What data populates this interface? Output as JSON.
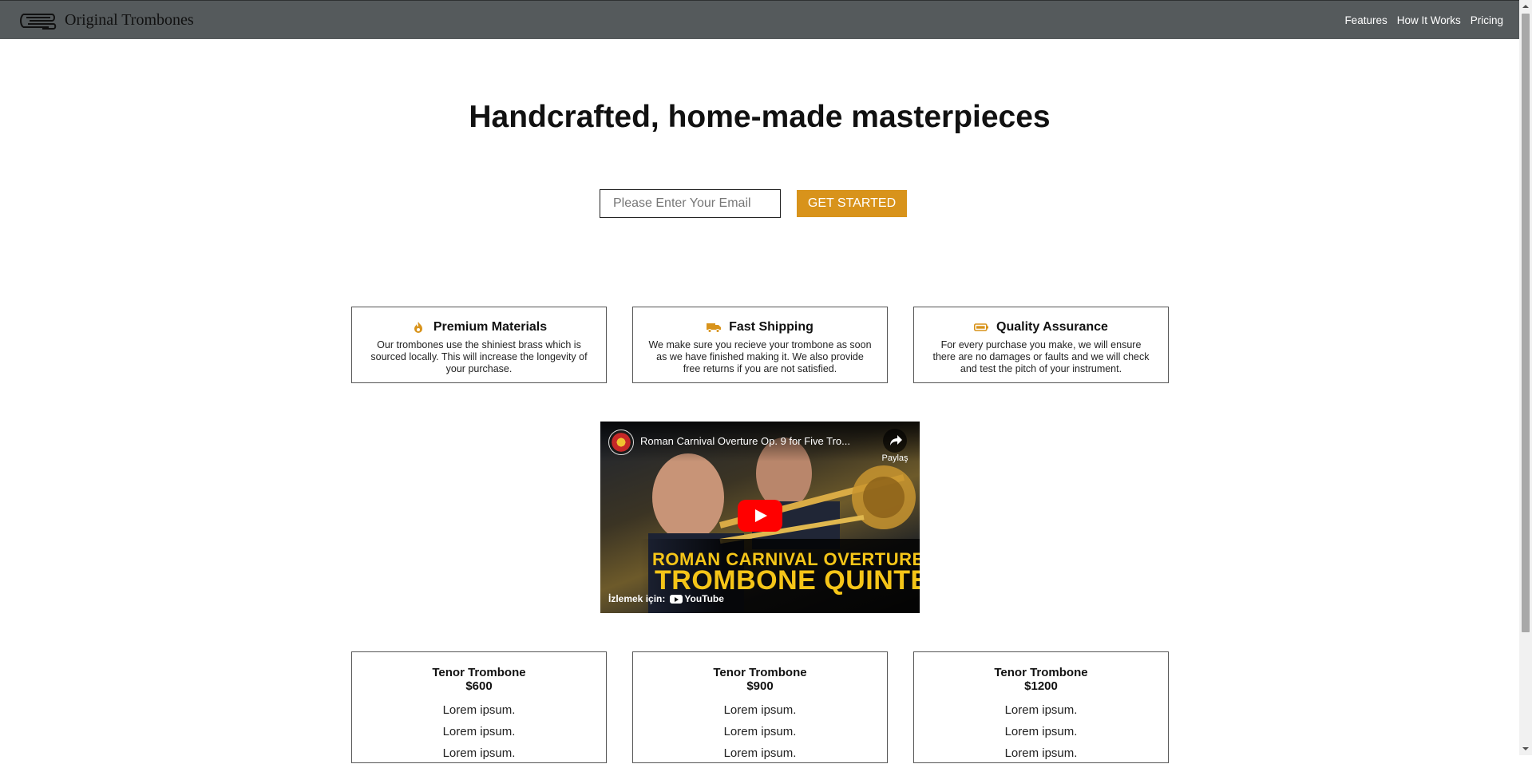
{
  "header": {
    "brand": "Original Trombones",
    "logo_icon": "trombone-icon",
    "nav": [
      {
        "label": "Features"
      },
      {
        "label": "How It Works"
      },
      {
        "label": "Pricing"
      }
    ]
  },
  "hero": {
    "title": "Handcrafted, home-made masterpieces",
    "email_placeholder": "Please Enter Your Email",
    "cta_label": "GET STARTED"
  },
  "features": [
    {
      "icon": "fire-icon",
      "title": "Premium Materials",
      "description": "Our trombones use the shiniest brass which is sourced locally. This will increase the longevity of your purchase."
    },
    {
      "icon": "truck-icon",
      "title": "Fast Shipping",
      "description": "We make sure you recieve your trombone as soon as we have finished making it. We also provide free returns if you are not satisfied."
    },
    {
      "icon": "battery-icon",
      "title": "Quality Assurance",
      "description": "For every purchase you make, we will ensure there are no damages or faults and we will check and test the pitch of your instrument."
    }
  ],
  "video": {
    "title": "Roman Carnival Overture Op. 9 for Five Tro...",
    "share_label": "Paylaş",
    "overlay_line1": "ROMAN CARNIVAL OVERTURE",
    "overlay_line2": "TROMBONE QUINTET",
    "watch_label": "İzlemek için:",
    "platform": "YouTube"
  },
  "pricing": [
    {
      "name": "Tenor Trombone",
      "price": "$600",
      "features": [
        "Lorem ipsum.",
        "Lorem ipsum.",
        "Lorem ipsum."
      ]
    },
    {
      "name": "Tenor Trombone",
      "price": "$900",
      "features": [
        "Lorem ipsum.",
        "Lorem ipsum.",
        "Lorem ipsum."
      ]
    },
    {
      "name": "Tenor Trombone",
      "price": "$1200",
      "features": [
        "Lorem ipsum.",
        "Lorem ipsum.",
        "Lorem ipsum."
      ]
    }
  ],
  "colors": {
    "header_bg": "#555a5c",
    "accent": "#d8931b",
    "youtube_red": "#ff0000",
    "overlay_yellow": "#f5c518"
  }
}
